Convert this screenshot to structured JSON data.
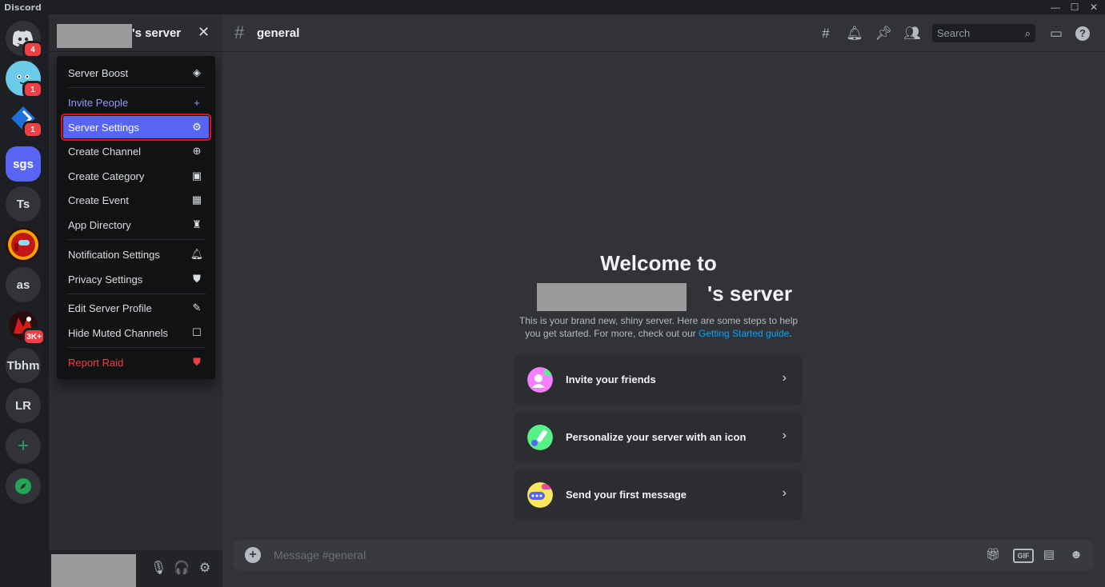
{
  "app": {
    "title": "Discord"
  },
  "window": {
    "min": "—",
    "max": "☐",
    "close": "✕"
  },
  "rail": {
    "servers": [
      {
        "label": "",
        "icon": "discord-home-icon",
        "badge": "4"
      },
      {
        "label": "",
        "icon": "emoji-avatar-icon",
        "badge": "1"
      },
      {
        "label": "",
        "icon": "blue-diamond-icon",
        "badge": "1"
      },
      {
        "label": "sgs",
        "badge": ""
      },
      {
        "label": "Ts",
        "badge": ""
      },
      {
        "label": "",
        "icon": "among-us-icon",
        "badge": ""
      },
      {
        "label": "as",
        "badge": ""
      },
      {
        "label": "",
        "icon": "red-server-icon",
        "badge": "3K+"
      },
      {
        "label": "Tbhm",
        "badge": ""
      },
      {
        "label": "LR",
        "badge": ""
      }
    ],
    "add_label": "+",
    "discover_icon": "compass-icon"
  },
  "sidebar": {
    "server_name_suffix": "'s server",
    "close_glyph": "✕"
  },
  "menu": {
    "items": [
      {
        "label": "Server Boost",
        "icon": "boost-gem-icon",
        "glyph": "◈"
      },
      {
        "label": "Invite People",
        "icon": "add-person-icon",
        "glyph": "👤"
      },
      {
        "label": "Server Settings",
        "icon": "gear-icon",
        "glyph": "⚙"
      },
      {
        "label": "Create Channel",
        "icon": "plus-circle-icon",
        "glyph": "⊕"
      },
      {
        "label": "Create Category",
        "icon": "folder-plus-icon",
        "glyph": "▣"
      },
      {
        "label": "Create Event",
        "icon": "calendar-plus-icon",
        "glyph": "▦"
      },
      {
        "label": "App Directory",
        "icon": "robot-icon",
        "glyph": "♜"
      },
      {
        "label": "Notification Settings",
        "icon": "bell-icon",
        "glyph": "🔔"
      },
      {
        "label": "Privacy Settings",
        "icon": "shield-icon",
        "glyph": "⛊"
      },
      {
        "label": "Edit Server Profile",
        "icon": "pencil-icon",
        "glyph": "✎"
      },
      {
        "label": "Hide Muted Channels",
        "icon": "checkbox-icon",
        "glyph": "☐"
      },
      {
        "label": "Report Raid",
        "icon": "shield-alert-icon",
        "glyph": "⛊"
      }
    ]
  },
  "channel": {
    "hash": "#",
    "name": "general"
  },
  "toolbar": {
    "search_placeholder": "Search"
  },
  "welcome": {
    "line1": "Welcome to",
    "line2_suffix": "'s server",
    "desc_prefix": "This is your brand new, shiny server. Here are some steps to help you get started. For more, check out our ",
    "desc_link": "Getting Started guide",
    "desc_suffix": "."
  },
  "cards": [
    {
      "label": "Invite your friends",
      "icon": "invite-friends-icon",
      "color": "#f47fff"
    },
    {
      "label": "Personalize your server with an icon",
      "icon": "paintbrush-icon",
      "color": "#57f287"
    },
    {
      "label": "Send your first message",
      "icon": "chat-bubble-icon",
      "color": "#fee75c"
    }
  ],
  "composer": {
    "placeholder": "Message #general",
    "gif_label": "GIF"
  },
  "colors": {
    "accent": "#5865f2",
    "highlight_outline": "#e0121f",
    "danger": "#f23f43",
    "link": "#00a8fc"
  }
}
